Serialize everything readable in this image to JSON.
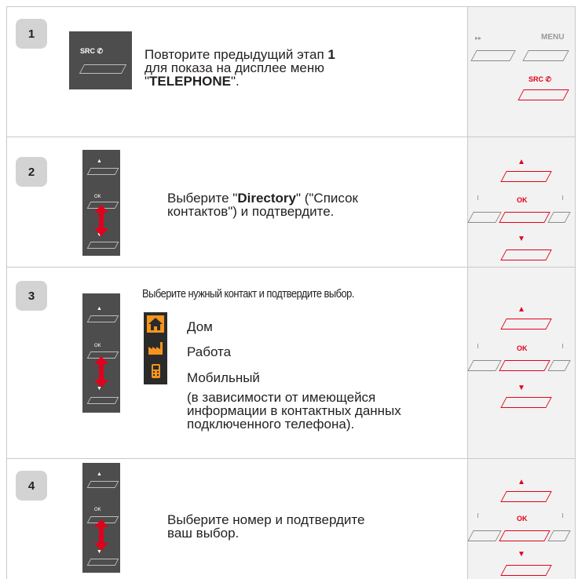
{
  "steps": [
    {
      "number": "1",
      "text_pre": "Повторите предыдущий этап ",
      "text_bold": "1",
      "text_line2": "для показа на дисплее меню",
      "text_quote_open": "\"",
      "text_line3_bold": "TELEPHONE",
      "text_line3_end": "\".",
      "button_label": "SRC",
      "panel": {
        "menu_label": "MENU",
        "fwd_symbol": "▸▸",
        "src_label": "SRC"
      }
    },
    {
      "number": "2",
      "text_pre": "Выберите \"",
      "text_bold": "Directory",
      "text_post": "\" (\"Список",
      "text_line2": "контактов\") и подтвердите.",
      "ok_label": "OK"
    },
    {
      "number": "3",
      "heading": "Выберите нужный контакт и подтвердите выбор.",
      "options": [
        {
          "label": "Дом",
          "icon": "home-icon"
        },
        {
          "label": "Работа",
          "icon": "factory-icon"
        },
        {
          "label": "Мобильный",
          "icon": "mobile-phone-icon"
        }
      ],
      "note_lines": [
        "(в зависимости от имеющейся",
        "информации в контактных данных",
        "подключенного телефона)."
      ],
      "ok_label": "OK"
    },
    {
      "number": "4",
      "text_line1": "Выберите номер и подтвердите",
      "text_line2": "ваш выбор.",
      "ok_label": "OK"
    }
  ],
  "colors": {
    "accent_red": "#e2001a",
    "pad_gray": "#4d4d4d",
    "icon_orange": "#f7941d",
    "badge_gray": "#d3d3d3"
  }
}
